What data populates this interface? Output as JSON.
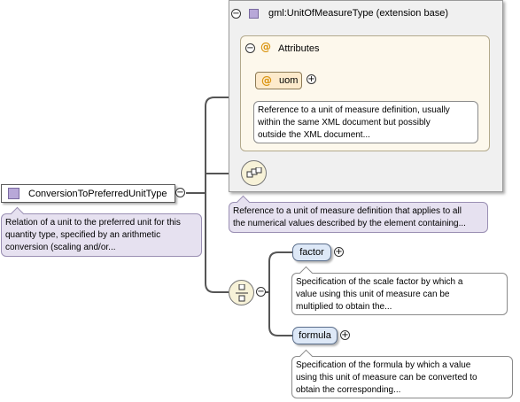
{
  "extension": {
    "title": "gml:UnitOfMeasureType (extension base)",
    "attributes_label": "Attributes",
    "uom": {
      "name": "uom",
      "doc": [
        "Reference to a unit of measure definition, usually",
        "within the same XML document but possibly",
        "outside the XML document..."
      ]
    }
  },
  "root": {
    "name": "ConversionToPreferredUnitType",
    "doc": [
      "Relation of a unit to the preferred unit for this",
      "quantity type, specified by an arithmetic",
      "conversion (scaling and/or..."
    ]
  },
  "extension_doc": [
    "Reference to a unit of measure definition that applies to all",
    "the numerical values described by the element containing..."
  ],
  "children": [
    {
      "name": "factor",
      "doc": [
        "Specification of the scale factor by which a",
        "value using this unit of measure can be",
        "multiplied to obtain the..."
      ]
    },
    {
      "name": "formula",
      "doc": [
        "Specification of the formula by which a value",
        "using this unit of measure can be converted to",
        "obtain the corresponding..."
      ]
    }
  ],
  "colors": {
    "type_icon": "#b8a8d8",
    "attribute_icon": "#d9930e",
    "element_pill": "#dde8f7",
    "root_doc": "#e6e1f0"
  },
  "icons": [
    "collapse-icon",
    "expand-icon",
    "type-icon",
    "attribute-icon",
    "extension-sequence-icon",
    "choice-compositor-icon"
  ]
}
